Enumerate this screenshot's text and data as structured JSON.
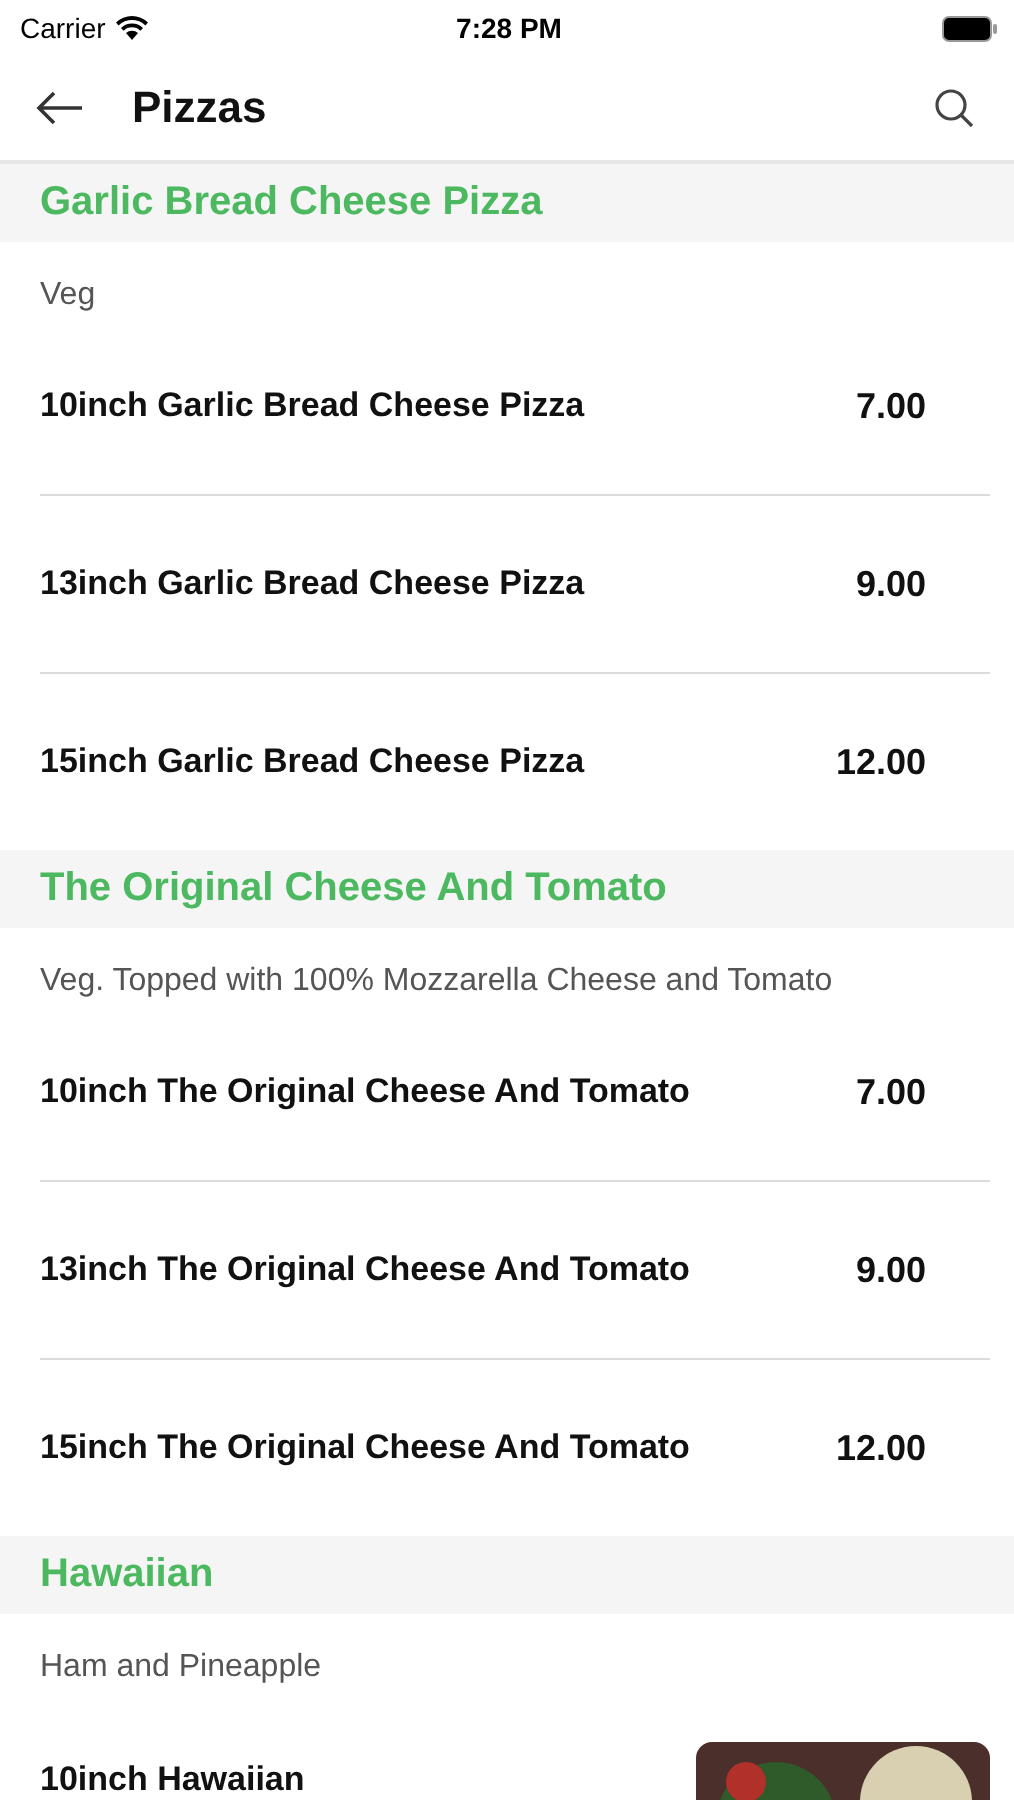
{
  "status_bar": {
    "carrier": "Carrier",
    "time": "7:28 PM"
  },
  "header": {
    "title": "Pizzas"
  },
  "sections": [
    {
      "title": "Garlic Bread Cheese Pizza",
      "description": "Veg",
      "items": [
        {
          "name": "10inch Garlic Bread Cheese Pizza",
          "price": "7.00"
        },
        {
          "name": "13inch Garlic Bread Cheese Pizza",
          "price": "9.00"
        },
        {
          "name": "15inch Garlic Bread Cheese Pizza",
          "price": "12.00"
        }
      ]
    },
    {
      "title": "The Original Cheese And Tomato",
      "description": "Veg. Topped with 100% Mozzarella Cheese and Tomato",
      "items": [
        {
          "name": "10inch The Original Cheese And Tomato",
          "price": "7.00"
        },
        {
          "name": "13inch The Original Cheese And Tomato",
          "price": "9.00"
        },
        {
          "name": "15inch The Original Cheese And Tomato",
          "price": "12.00"
        }
      ]
    },
    {
      "title": "Hawaiian",
      "description": "Ham and Pineapple",
      "items": [
        {
          "name": "10inch Hawaiian",
          "kind": "picture"
        }
      ]
    }
  ]
}
